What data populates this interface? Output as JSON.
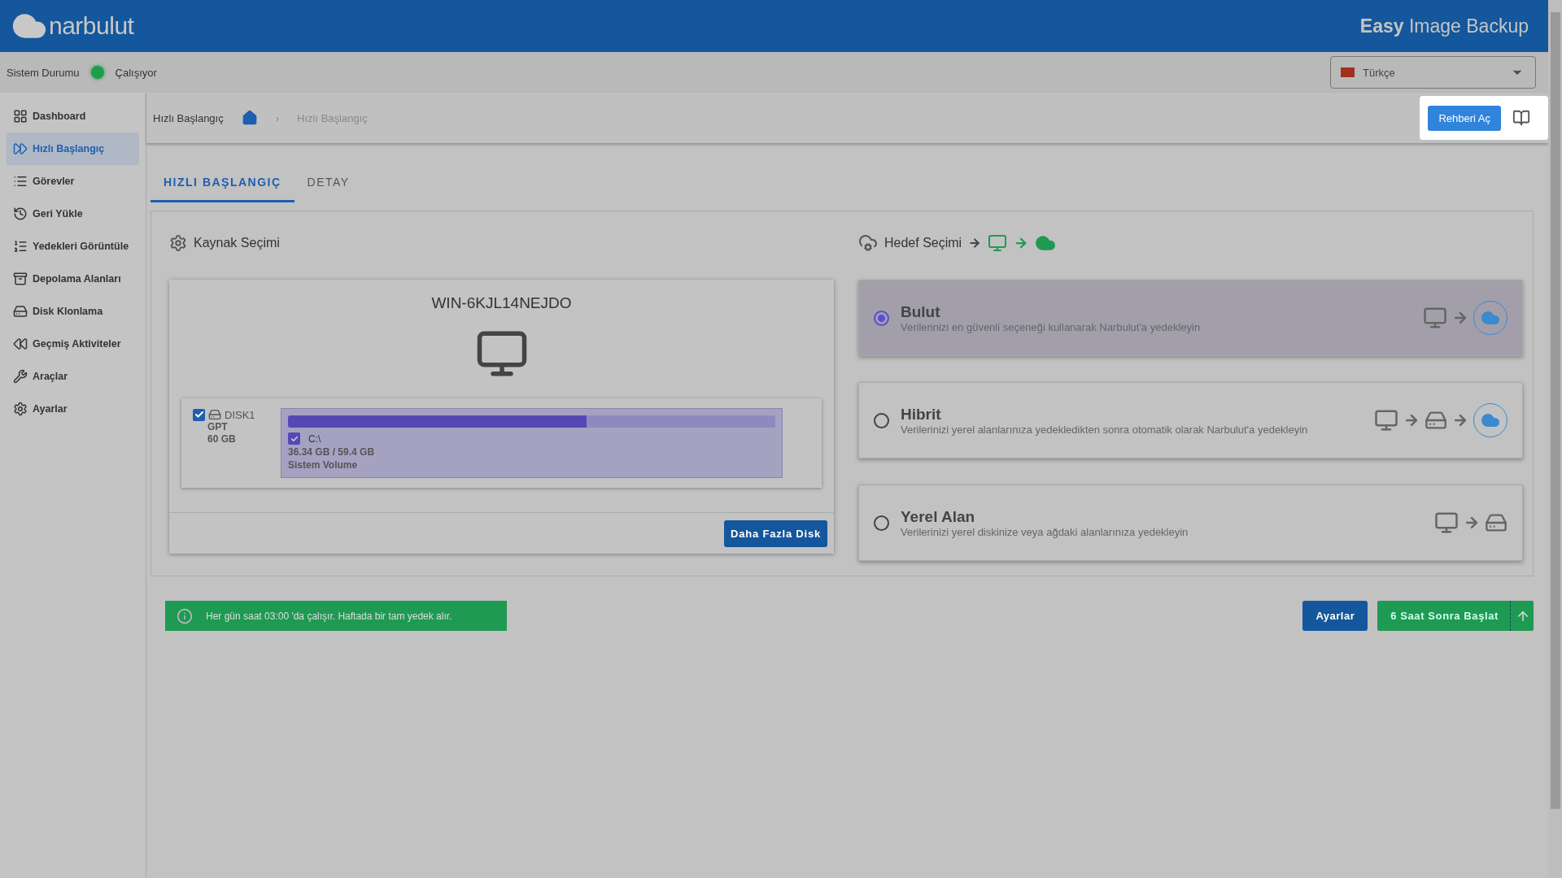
{
  "header": {
    "logo_text": "narbulut",
    "product": "**Easy** Image Backup"
  },
  "status": {
    "label": "Sistem Durumu",
    "value": "Çalışıyor",
    "color": "#1e9e4a"
  },
  "language": {
    "value": "Türkçe"
  },
  "sidebar": {
    "items": [
      {
        "label": "Dashboard",
        "selected": false
      },
      {
        "label": "Hızlı Başlangıç",
        "selected": true
      },
      {
        "label": "Görevler",
        "selected": false
      },
      {
        "label": "Geri Yükle",
        "selected": false
      },
      {
        "label": "Yedekleri Görüntüle",
        "selected": false
      },
      {
        "label": "Depolama Alanları",
        "selected": false
      },
      {
        "label": "Disk Klonlama",
        "selected": false
      },
      {
        "label": "Geçmiş Aktiviteler",
        "selected": false
      },
      {
        "label": "Araçlar",
        "selected": false
      },
      {
        "label": "Ayarlar",
        "selected": false
      }
    ]
  },
  "breadcrumb": {
    "title": "Hızlı Başlangıç",
    "current": "Hızlı Başlangıç",
    "separator": "›"
  },
  "guide_button": "Rehberi Aç",
  "tabs": [
    {
      "label": "HIZLI BAŞLANGIÇ",
      "selected": true
    },
    {
      "label": "DETAY",
      "selected": false
    }
  ],
  "source": {
    "heading": "Kaynak Seçimi",
    "computer": "WIN-6KJL14NEJDO",
    "disks": [
      {
        "name": "DISK1",
        "checked": true,
        "style": "GPT",
        "size": "60 GB",
        "partitions": [
          {
            "letter": "C:\\",
            "checked": true,
            "level": 0.612,
            "usage": "36.34 GB / 59.4 GB",
            "label": "Sistem Volume"
          }
        ]
      }
    ],
    "more_button": "Daha Fazla Disk"
  },
  "target": {
    "heading": "Hedef Seçimi",
    "options": [
      {
        "kind": "cloud",
        "title": "Bulut",
        "description": "Verilerinizi en güvenli seçeneği kullanarak Narbulut'a yedekleyin",
        "selected": true
      },
      {
        "kind": "hybrid",
        "title": "Hibrit",
        "description": "Verilerinizi yerel alanlarınıza yedekledikten sonra otomatik olarak Narbulut'a yedekleyin",
        "selected": false
      },
      {
        "kind": "local",
        "title": "Yerel Alan",
        "description": "Verilerinizi yerel diskinize veya ağdaki alanlarınıza yedekleyin",
        "selected": false
      }
    ]
  },
  "schedule_note": "Her gün saat 03:00 'da çalışır. Haftada bir tam yedek alır.",
  "settings_button": "Ayarlar",
  "start_button": "6 Saat Sonra Başlat"
}
